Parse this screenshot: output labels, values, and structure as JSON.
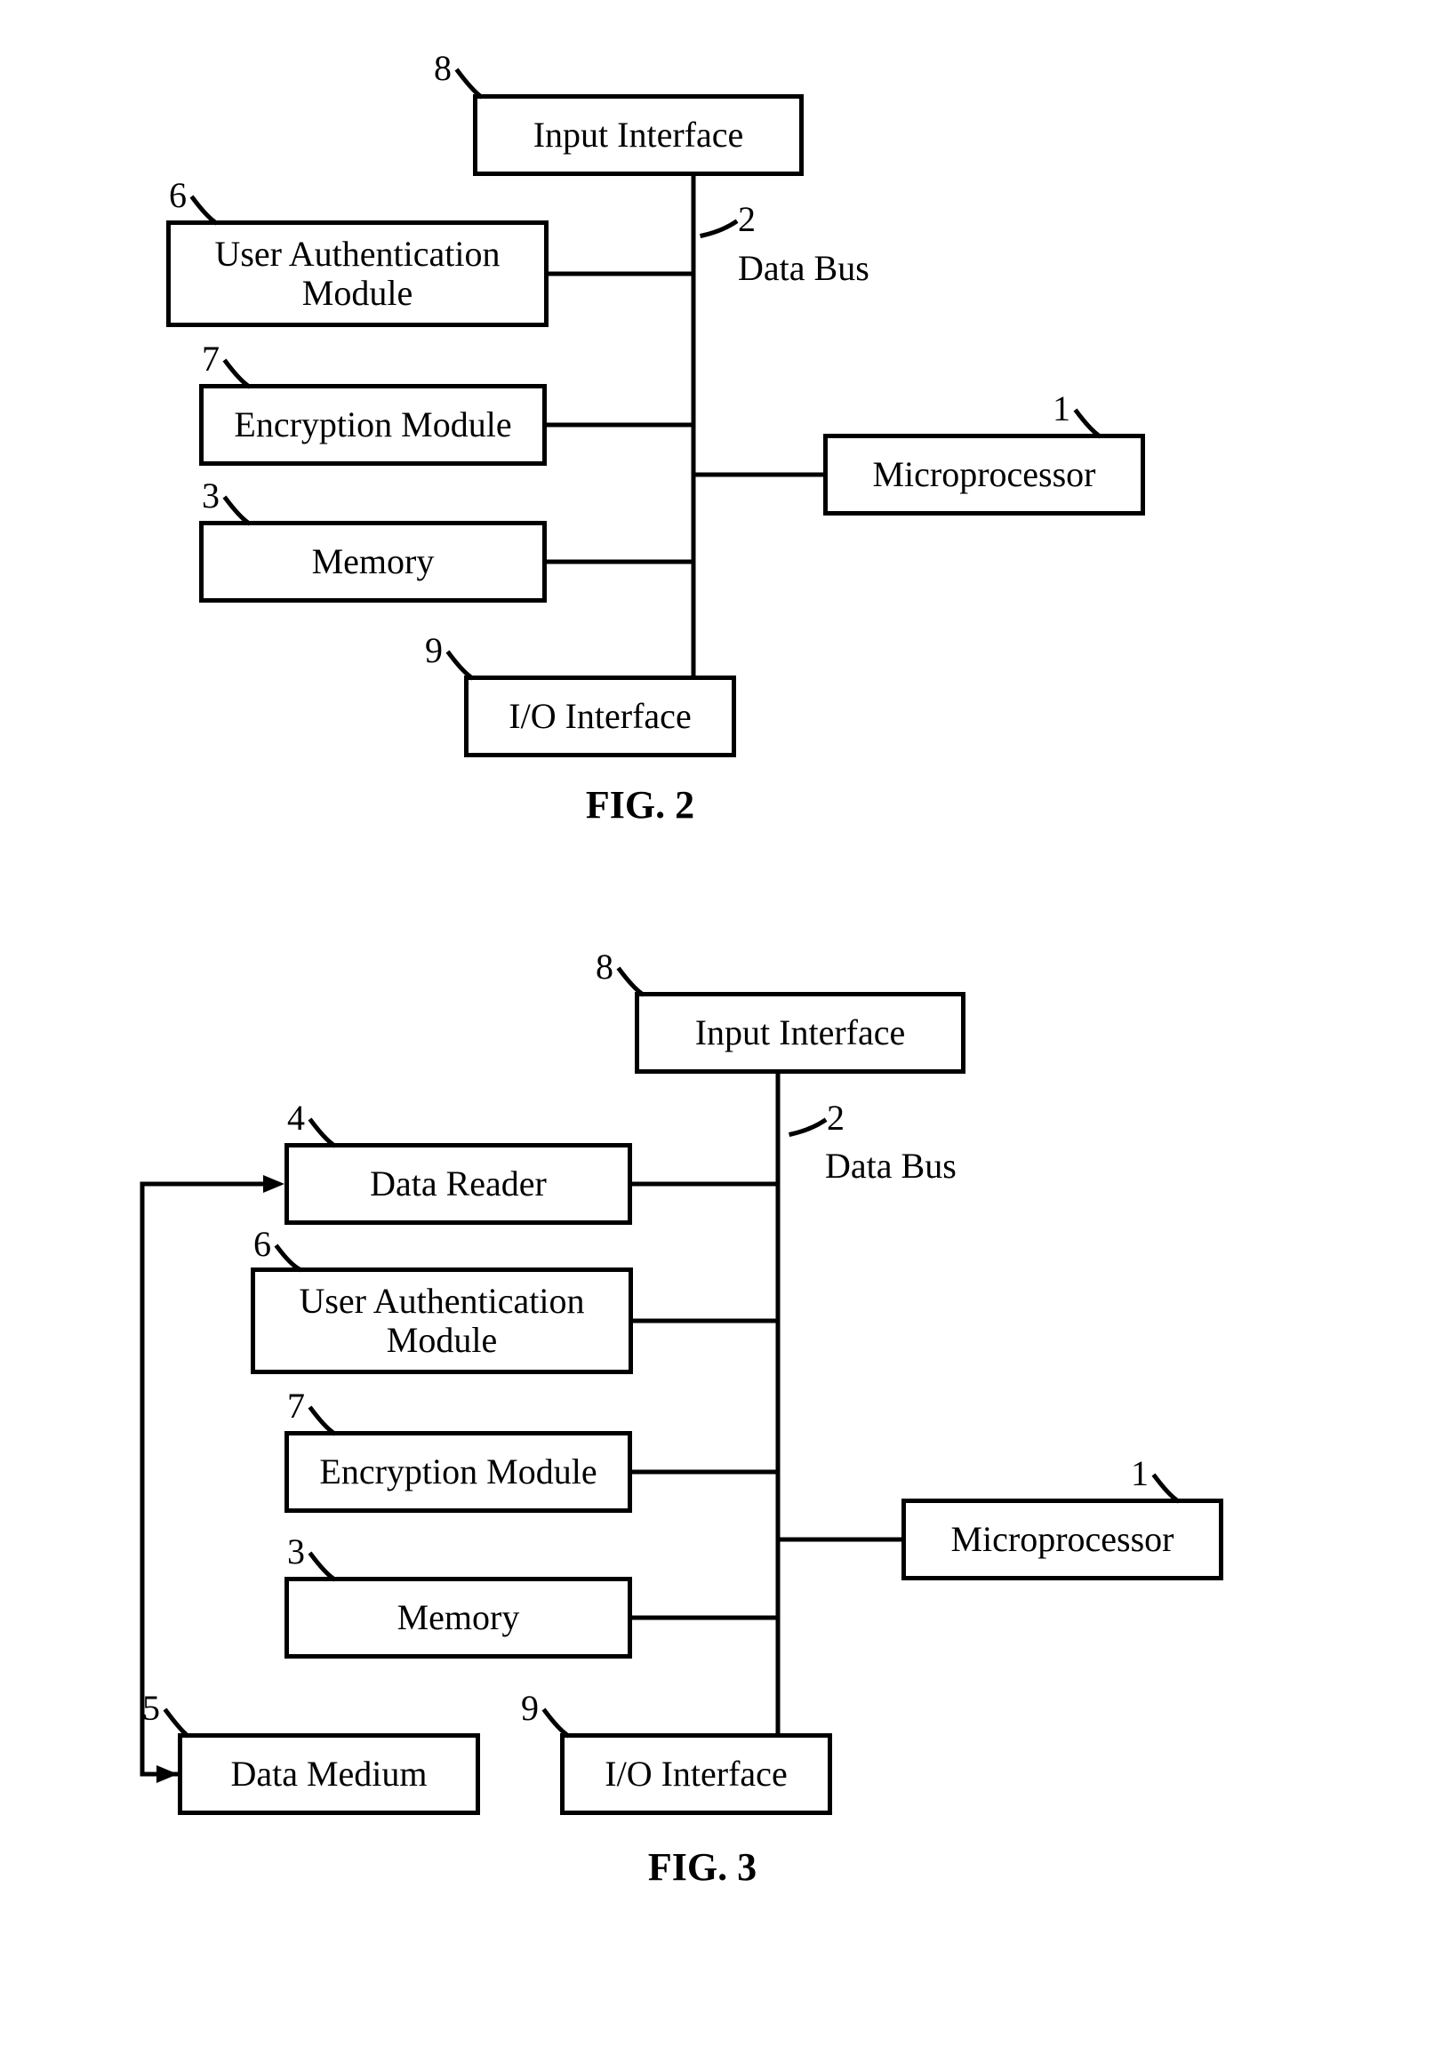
{
  "fig2": {
    "caption": "FIG. 2",
    "bus_label": "Data Bus",
    "refs": {
      "microprocessor": "1",
      "bus": "2",
      "memory": "3",
      "auth": "6",
      "encrypt": "7",
      "input": "8",
      "io": "9"
    },
    "boxes": {
      "input": "Input Interface",
      "auth": "User Authentication Module",
      "encrypt": "Encryption Module",
      "memory": "Memory",
      "microprocessor": "Microprocessor",
      "io": "I/O Interface"
    }
  },
  "fig3": {
    "caption": "FIG. 3",
    "bus_label": "Data Bus",
    "refs": {
      "microprocessor": "1",
      "bus": "2",
      "memory": "3",
      "reader": "4",
      "medium": "5",
      "auth": "6",
      "encrypt": "7",
      "input": "8",
      "io": "9"
    },
    "boxes": {
      "input": "Input Interface",
      "reader": "Data Reader",
      "auth": "User Authentication Module",
      "encrypt": "Encryption Module",
      "memory": "Memory",
      "microprocessor": "Microprocessor",
      "io": "I/O Interface",
      "medium": "Data Medium"
    }
  }
}
